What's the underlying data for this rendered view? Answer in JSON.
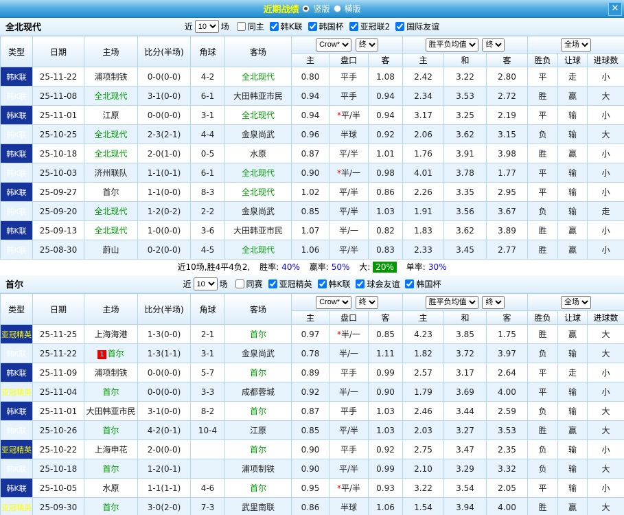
{
  "topbar": {
    "title": "近期战绩",
    "radio_vertical": "竖版",
    "radio_horizontal": "横版",
    "close": "✕"
  },
  "colors": {
    "type_bg": "#17349c",
    "win_red": "#e80000",
    "lose_green": "#009900",
    "push_blue": "#0000ee",
    "odds_blue": "#1d3994",
    "highlight_green_bg": "#009900",
    "title_yellow": "#ffff00"
  },
  "sections": [
    {
      "team": "全北现代",
      "filter": {
        "near_label": "近",
        "count": "10",
        "games_label": "场",
        "checkboxes": [
          {
            "label": "同主",
            "checked": false
          },
          {
            "label": "韩K联",
            "checked": true
          },
          {
            "label": "韩国杯",
            "checked": true
          },
          {
            "label": "亚冠联2",
            "checked": true
          },
          {
            "label": "国际友谊",
            "checked": true
          }
        ]
      },
      "table": {
        "col_headers": [
          "类型",
          "日期",
          "主场",
          "比分(半场)",
          "角球",
          "客场"
        ],
        "group1_select": "Crow*",
        "group1_final": "终",
        "group2_select": "胜平负均值",
        "group2_final": "终",
        "group3_select": "全场",
        "sub_headers": [
          "主",
          "盘口",
          "客",
          "主",
          "和",
          "客",
          "胜负",
          "让球",
          "进球数"
        ],
        "rows": [
          {
            "league": "韩K联",
            "league_color": "white",
            "date": "25-11-22",
            "home": "浦项制铁",
            "home_green": false,
            "home_badge": "",
            "score": "0-0(0-0)",
            "corner": "4-2",
            "away": "全北现代",
            "away_green": true,
            "ah_home": "0.80",
            "ah_line": "平手",
            "ah_away": "1.08",
            "eu_home": "2.42",
            "eu_draw": "3.22",
            "eu_away": "2.80",
            "result": "平",
            "result_color": "dark",
            "handicap": "走",
            "handicap_color": "blue",
            "goals": "小",
            "goals_color": "dark"
          },
          {
            "league": "韩K联",
            "league_color": "white",
            "date": "25-11-08",
            "home": "全北现代",
            "home_green": true,
            "home_badge": "",
            "score": "3-1(0-0)",
            "corner": "6-1",
            "away": "大田韩亚市民",
            "away_green": false,
            "ah_home": "0.94",
            "ah_line": "平手",
            "ah_away": "0.94",
            "eu_home": "2.34",
            "eu_draw": "3.53",
            "eu_away": "2.72",
            "result": "胜",
            "result_color": "red",
            "handicap": "赢",
            "handicap_color": "red",
            "goals": "大",
            "goals_color": "red"
          },
          {
            "league": "韩K联",
            "league_color": "white",
            "date": "25-11-01",
            "home": "江原",
            "home_green": false,
            "home_badge": "",
            "score": "0-0(0-0)",
            "corner": "3-1",
            "away": "全北现代",
            "away_green": true,
            "ah_home": "0.94",
            "ah_line": "*平/半",
            "ah_away": "0.94",
            "eu_home": "3.17",
            "eu_draw": "3.25",
            "eu_away": "2.19",
            "result": "平",
            "result_color": "dark",
            "handicap": "输",
            "handicap_color": "green",
            "goals": "小",
            "goals_color": "dark"
          },
          {
            "league": "韩K联",
            "league_color": "white",
            "date": "25-10-25",
            "home": "全北现代",
            "home_green": true,
            "home_badge": "",
            "score": "2-3(2-1)",
            "corner": "4-4",
            "away": "金泉尚武",
            "away_green": false,
            "ah_home": "0.96",
            "ah_line": "半球",
            "ah_away": "0.92",
            "eu_home": "2.06",
            "eu_draw": "3.62",
            "eu_away": "3.15",
            "result": "负",
            "result_color": "green",
            "handicap": "输",
            "handicap_color": "green",
            "goals": "大",
            "goals_color": "red"
          },
          {
            "league": "韩K联",
            "league_color": "white",
            "date": "25-10-18",
            "home": "全北现代",
            "home_green": true,
            "home_badge": "",
            "score": "2-0(1-0)",
            "corner": "0-5",
            "away": "水原",
            "away_green": false,
            "ah_home": "0.87",
            "ah_line": "平/半",
            "ah_away": "1.01",
            "eu_home": "1.76",
            "eu_draw": "3.91",
            "eu_away": "3.98",
            "result": "胜",
            "result_color": "red",
            "handicap": "赢",
            "handicap_color": "red",
            "goals": "小",
            "goals_color": "dark"
          },
          {
            "league": "韩K联",
            "league_color": "white",
            "date": "25-10-03",
            "home": "济州联队",
            "home_green": false,
            "home_badge": "",
            "score": "1-1(0-1)",
            "corner": "6-1",
            "away": "全北现代",
            "away_green": true,
            "ah_home": "0.90",
            "ah_line": "*半/一",
            "ah_away": "0.98",
            "eu_home": "4.01",
            "eu_draw": "3.78",
            "eu_away": "1.77",
            "result": "平",
            "result_color": "dark",
            "handicap": "输",
            "handicap_color": "green",
            "goals": "小",
            "goals_color": "dark"
          },
          {
            "league": "韩K联",
            "league_color": "white",
            "date": "25-09-27",
            "home": "首尔",
            "home_green": false,
            "home_badge": "",
            "score": "1-1(0-0)",
            "corner": "8-3",
            "away": "全北现代",
            "away_green": true,
            "ah_home": "1.02",
            "ah_line": "平/半",
            "ah_away": "0.86",
            "eu_home": "2.26",
            "eu_draw": "3.35",
            "eu_away": "2.95",
            "result": "平",
            "result_color": "dark",
            "handicap": "输",
            "handicap_color": "green",
            "goals": "小",
            "goals_color": "dark"
          },
          {
            "league": "韩K联",
            "league_color": "white",
            "date": "25-09-20",
            "home": "全北现代",
            "home_green": true,
            "home_badge": "",
            "score": "1-2(0-2)",
            "corner": "2-2",
            "away": "金泉尚武",
            "away_green": false,
            "ah_home": "0.85",
            "ah_line": "平/半",
            "ah_away": "1.03",
            "eu_home": "1.91",
            "eu_draw": "3.56",
            "eu_away": "3.67",
            "result": "负",
            "result_color": "green",
            "handicap": "输",
            "handicap_color": "green",
            "goals": "走",
            "goals_color": "blue"
          },
          {
            "league": "韩K联",
            "league_color": "white",
            "date": "25-09-13",
            "home": "全北现代",
            "home_green": true,
            "home_badge": "",
            "score": "1-0(0-0)",
            "corner": "3-6",
            "away": "大田韩亚市民",
            "away_green": false,
            "ah_home": "1.07",
            "ah_line": "半/一",
            "ah_away": "0.82",
            "eu_home": "1.83",
            "eu_draw": "3.62",
            "eu_away": "3.89",
            "result": "胜",
            "result_color": "red",
            "handicap": "赢",
            "handicap_color": "red",
            "goals": "小",
            "goals_color": "dark"
          },
          {
            "league": "韩K联",
            "league_color": "white",
            "date": "25-08-30",
            "home": "蔚山",
            "home_green": false,
            "home_badge": "",
            "score": "0-2(0-0)",
            "corner": "4-5",
            "away": "全北现代",
            "away_green": true,
            "ah_home": "1.06",
            "ah_line": "平/半",
            "ah_away": "0.83",
            "eu_home": "2.33",
            "eu_draw": "3.45",
            "eu_away": "2.77",
            "result": "胜",
            "result_color": "red",
            "handicap": "赢",
            "handicap_color": "red",
            "goals": "小",
            "goals_color": "dark"
          }
        ]
      },
      "summary": {
        "record": "近10场,胜4平4负2,",
        "win_label": "胜率:",
        "win_value": "40%",
        "profit_label": "赢率:",
        "profit_value": "50%",
        "big_label": "大:",
        "big_value": "20%",
        "single_label": "单率:",
        "single_value": "30%"
      }
    },
    {
      "team": "首尔",
      "filter": {
        "near_label": "近",
        "count": "10",
        "games_label": "场",
        "checkboxes": [
          {
            "label": "同赛",
            "checked": false
          },
          {
            "label": "亚冠精英",
            "checked": true
          },
          {
            "label": "韩K联",
            "checked": true
          },
          {
            "label": "球会友谊",
            "checked": true
          },
          {
            "label": "韩国杯",
            "checked": true
          }
        ]
      },
      "table": {
        "col_headers": [
          "类型",
          "日期",
          "主场",
          "比分(半场)",
          "角球",
          "客场"
        ],
        "group1_select": "Crow*",
        "group1_final": "终",
        "group2_select": "胜平负均值",
        "group2_final": "终",
        "group3_select": "全场",
        "sub_headers": [
          "主",
          "盘口",
          "客",
          "主",
          "和",
          "客",
          "胜负",
          "让球",
          "进球数"
        ],
        "rows": [
          {
            "league": "亚冠精英",
            "league_color": "yellow",
            "date": "25-11-25",
            "home": "上海海港",
            "home_green": false,
            "home_badge": "",
            "score": "1-3(0-0)",
            "corner": "2-1",
            "away": "首尔",
            "away_green": true,
            "ah_home": "0.97",
            "ah_line": "*半/一",
            "ah_away": "0.85",
            "eu_home": "4.23",
            "eu_draw": "3.85",
            "eu_away": "1.75",
            "result": "胜",
            "result_color": "red",
            "handicap": "赢",
            "handicap_color": "red",
            "goals": "大",
            "goals_color": "red"
          },
          {
            "league": "韩K联",
            "league_color": "white",
            "date": "25-11-22",
            "home": "首尔",
            "home_green": true,
            "home_badge": "1",
            "score": "1-3(1-1)",
            "corner": "3-1",
            "away": "金泉尚武",
            "away_green": false,
            "ah_home": "0.78",
            "ah_line": "半/一",
            "ah_away": "1.11",
            "eu_home": "1.82",
            "eu_draw": "3.72",
            "eu_away": "3.97",
            "result": "负",
            "result_color": "green",
            "handicap": "输",
            "handicap_color": "green",
            "goals": "大",
            "goals_color": "red"
          },
          {
            "league": "韩K联",
            "league_color": "white",
            "date": "25-11-09",
            "home": "浦项制铁",
            "home_green": false,
            "home_badge": "",
            "score": "0-0(0-0)",
            "corner": "5-7",
            "away": "首尔",
            "away_green": true,
            "ah_home": "0.89",
            "ah_line": "平手",
            "ah_away": "0.99",
            "eu_home": "2.57",
            "eu_draw": "3.17",
            "eu_away": "2.64",
            "result": "平",
            "result_color": "dark",
            "handicap": "走",
            "handicap_color": "blue",
            "goals": "小",
            "goals_color": "dark"
          },
          {
            "league": "亚冠精英",
            "league_color": "yellow",
            "date": "25-11-04",
            "home": "首尔",
            "home_green": true,
            "home_badge": "",
            "score": "0-0(0-0)",
            "corner": "3-3",
            "away": "成都蓉城",
            "away_green": false,
            "ah_home": "0.92",
            "ah_line": "半/一",
            "ah_away": "0.90",
            "eu_home": "1.79",
            "eu_draw": "3.69",
            "eu_away": "4.00",
            "result": "平",
            "result_color": "dark",
            "handicap": "输",
            "handicap_color": "green",
            "goals": "小",
            "goals_color": "dark"
          },
          {
            "league": "韩K联",
            "league_color": "white",
            "date": "25-11-01",
            "home": "大田韩亚市民",
            "home_green": false,
            "home_badge": "",
            "score": "3-1(0-0)",
            "corner": "8-2",
            "away": "首尔",
            "away_green": true,
            "ah_home": "0.87",
            "ah_line": "平手",
            "ah_away": "1.03",
            "eu_home": "2.46",
            "eu_draw": "3.44",
            "eu_away": "2.59",
            "result": "负",
            "result_color": "green",
            "handicap": "输",
            "handicap_color": "green",
            "goals": "大",
            "goals_color": "red"
          },
          {
            "league": "韩K联",
            "league_color": "white",
            "date": "25-10-26",
            "home": "首尔",
            "home_green": true,
            "home_badge": "",
            "score": "4-2(0-1)",
            "corner": "10-4",
            "away": "江原",
            "away_green": false,
            "ah_home": "0.85",
            "ah_line": "平/半",
            "ah_away": "1.03",
            "eu_home": "2.03",
            "eu_draw": "3.27",
            "eu_away": "3.53",
            "result": "胜",
            "result_color": "red",
            "handicap": "赢",
            "handicap_color": "red",
            "goals": "大",
            "goals_color": "red"
          },
          {
            "league": "亚冠精英",
            "league_color": "yellow",
            "date": "25-10-22",
            "home": "上海申花",
            "home_green": false,
            "home_badge": "",
            "score": "2-0(0-0)",
            "corner": "",
            "away": "首尔",
            "away_green": true,
            "ah_home": "0.90",
            "ah_line": "平手",
            "ah_away": "0.92",
            "eu_home": "2.75",
            "eu_draw": "3.47",
            "eu_away": "2.35",
            "result": "负",
            "result_color": "green",
            "handicap": "输",
            "handicap_color": "green",
            "goals": "小",
            "goals_color": "dark"
          },
          {
            "league": "韩K联",
            "league_color": "white",
            "date": "25-10-18",
            "home": "首尔",
            "home_green": true,
            "home_badge": "",
            "score": "1-2(0-1)",
            "corner": "",
            "away": "浦项制铁",
            "away_green": false,
            "ah_home": "0.90",
            "ah_line": "平/半",
            "ah_away": "0.99",
            "eu_home": "2.10",
            "eu_draw": "3.29",
            "eu_away": "3.32",
            "result": "负",
            "result_color": "green",
            "handicap": "输",
            "handicap_color": "green",
            "goals": "大",
            "goals_color": "red"
          },
          {
            "league": "韩K联",
            "league_color": "white",
            "date": "25-10-05",
            "home": "水原",
            "home_green": false,
            "home_badge": "",
            "score": "1-1(1-1)",
            "corner": "4-6",
            "away": "首尔",
            "away_green": true,
            "ah_home": "0.95",
            "ah_line": "*平/半",
            "ah_away": "0.93",
            "eu_home": "3.22",
            "eu_draw": "3.54",
            "eu_away": "2.05",
            "result": "平",
            "result_color": "dark",
            "handicap": "输",
            "handicap_color": "green",
            "goals": "小",
            "goals_color": "dark"
          },
          {
            "league": "亚冠精英",
            "league_color": "yellow",
            "date": "25-09-30",
            "home": "首尔",
            "home_green": true,
            "home_badge": "",
            "score": "3-0(2-0)",
            "corner": "7-3",
            "away": "武里南联",
            "away_green": false,
            "ah_home": "0.86",
            "ah_line": "半球",
            "ah_away": "1.06",
            "eu_home": "1.54",
            "eu_draw": "3.94",
            "eu_away": "4.00",
            "result": "胜",
            "result_color": "red",
            "handicap": "赢",
            "handicap_color": "red",
            "goals": "大",
            "goals_color": "red"
          }
        ]
      }
    }
  ]
}
